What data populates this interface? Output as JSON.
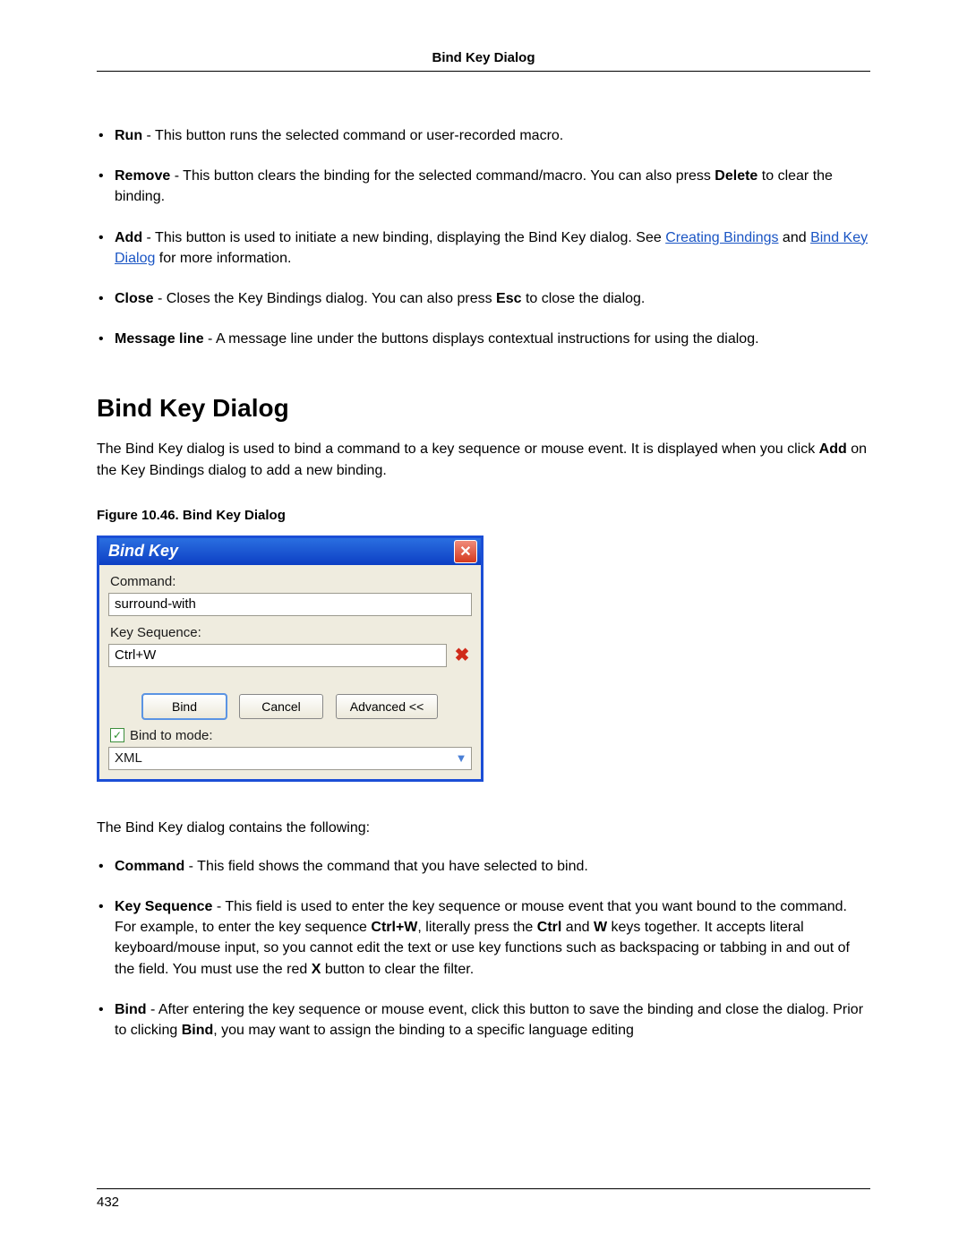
{
  "header": {
    "title": "Bind Key Dialog"
  },
  "list1": {
    "run": {
      "b": "Run",
      "t": " - This button runs the selected command or user-recorded macro."
    },
    "remove": {
      "b": "Remove",
      "t1": " - This button clears the binding for the selected command/macro. You can also press ",
      "b2": "Delete",
      "t2": " to clear the binding."
    },
    "add": {
      "b": "Add",
      "t1": " - This button is used to initiate a new binding, displaying the Bind Key dialog. See ",
      "link1": "Creating Bindings",
      "t2": " and ",
      "link2": "Bind Key Dialog",
      "t3": " for more information."
    },
    "close": {
      "b": "Close",
      "t1": " - Closes the Key Bindings dialog. You can also press ",
      "b2": "Esc",
      "t2": " to close the dialog."
    },
    "msg": {
      "b": "Message line",
      "t": " - A message line under the buttons displays contextual instructions for using the dialog."
    }
  },
  "section": {
    "heading": "Bind Key Dialog",
    "intro1": "The Bind Key dialog is used to bind a command to a key sequence or mouse event. It is displayed when you click ",
    "intro_b": "Add",
    "intro2": " on the Key Bindings dialog to add a new binding."
  },
  "figure": {
    "caption": "Figure 10.46.  Bind Key Dialog"
  },
  "dialog": {
    "title": "Bind Key",
    "command_label": "Command:",
    "command_value": "surround-with",
    "keyseq_label": "Key Sequence:",
    "keyseq_value": "Ctrl+W",
    "bind_btn": "Bind",
    "cancel_btn": "Cancel",
    "advanced_btn": "Advanced <<",
    "bindmode_label": "Bind to mode:",
    "mode_value": "XML"
  },
  "after_fig": "The Bind Key dialog contains the following:",
  "list2": {
    "command": {
      "b": "Command",
      "t": " - This field shows the command that you have selected to bind."
    },
    "keyseq": {
      "b": "Key Sequence",
      "t1": " - This field is used to enter the key sequence or mouse event that you want bound to the command. For example, to enter the key sequence ",
      "b2": "Ctrl+W",
      "t2": ", literally press the ",
      "b3": "Ctrl",
      "t3": " and ",
      "b4": "W",
      "t4": " keys together. It accepts literal keyboard/mouse input, so you cannot edit the text or use key functions such as backspacing or tabbing in and out of the field. You must use the red ",
      "b5": "X",
      "t5": " button to clear the filter."
    },
    "bind": {
      "b": "Bind",
      "t1": " - After entering the key sequence or mouse event, click this button to save the binding and close the dialog. Prior to clicking ",
      "b2": "Bind",
      "t2": ", you may want to assign the binding to a specific language editing"
    }
  },
  "page_number": "432"
}
